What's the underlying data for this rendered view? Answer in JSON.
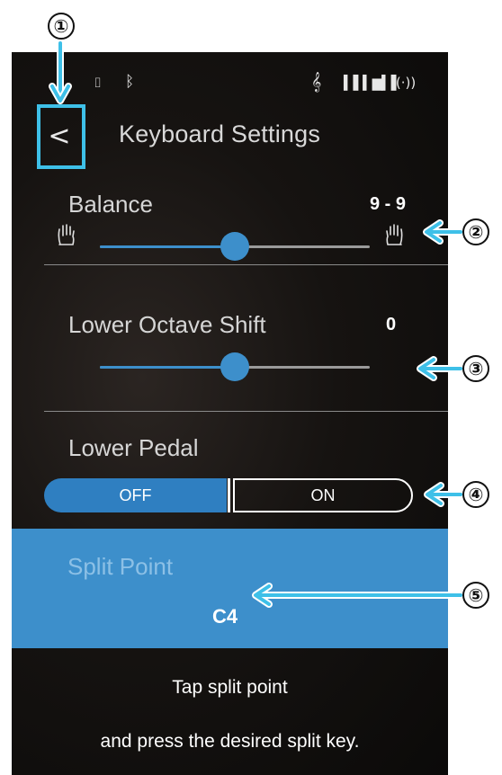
{
  "status_bar": {
    "icons": [
      "usb-flash-icon",
      "bluetooth-icon",
      "music-note-icon",
      "audio-meter-icon",
      "wireless-icon"
    ]
  },
  "header": {
    "back_glyph": "<",
    "title": "Keyboard Settings"
  },
  "balance": {
    "label": "Balance",
    "value": "9 - 9",
    "level": 0.5,
    "left_icon": "left-hand-icon",
    "right_icon": "right-hand-icon"
  },
  "lower_octave_shift": {
    "label": "Lower Octave Shift",
    "value": "0",
    "level": 0.5
  },
  "lower_pedal": {
    "label": "Lower Pedal",
    "off_label": "OFF",
    "on_label": "ON",
    "selected": "OFF"
  },
  "split_point": {
    "label": "Split Point",
    "value": "C4"
  },
  "hint": {
    "line1": "Tap split point",
    "line2": "and press the desired split key."
  },
  "callouts": [
    "①",
    "②",
    "③",
    "④",
    "⑤"
  ],
  "colors": {
    "accent": "#3d8fcb",
    "callout_highlight": "#3ec0e8",
    "background": "#141110"
  }
}
